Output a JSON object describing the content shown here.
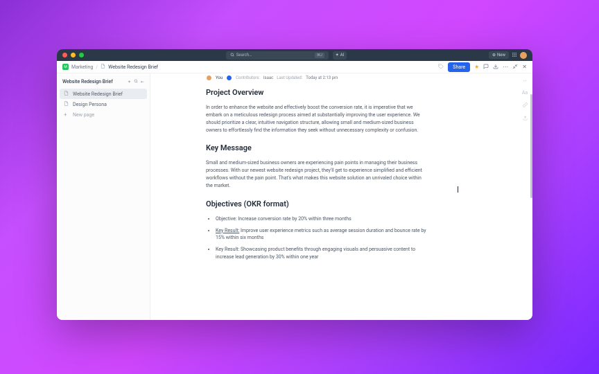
{
  "window": {
    "search_placeholder": "Search…",
    "search_shortcut": "⌘J",
    "ai_label": "AI",
    "new_label": "New"
  },
  "breadcrumbs": {
    "parent": "Marketing",
    "current": "Website Redesign Brief"
  },
  "toolbar": {
    "share_label": "Share"
  },
  "sidebar": {
    "header": "Website Redesign Brief",
    "items": [
      {
        "label": "Website Redesign Brief",
        "active": true
      },
      {
        "label": "Design Persona",
        "active": false
      }
    ],
    "new_page_label": "New page"
  },
  "doc_meta": {
    "current_user": "You",
    "contributors_label": "Contributors:",
    "contributors": "Isaac",
    "updated_label": "Last Updated:",
    "updated_value": "Today at 2:13 pm"
  },
  "document": {
    "sections": [
      {
        "heading": "Project Overview",
        "body": "In order to enhance the website and effectively boost the conversion rate, it is imperative that we embark on a meticulous redesign process aimed at substantially improving the user experience. We should prioritize a clear, intuitive navigation structure, allowing small and medium-sized business owners to effortlessly find the information they seek without unnecessary complexity or confusion."
      },
      {
        "heading": "Key Message",
        "body": "Small and medium-sized business owners are experiencing pain points in managing their business processes. With our newest website redesign project, they'll get to experience simplified and efficient workflows without the pain point. That's what makes this website solution an unrivaled choice within the market."
      },
      {
        "heading": "Objectives (OKR format)",
        "list": [
          {
            "prefix": "Objective:",
            "text": " Increase conversion rate by 20% within three months"
          },
          {
            "prefix": "Key Result:",
            "underline": true,
            "text": " Improve user experience metrics such as average session duration and bounce rate by 15% within six months"
          },
          {
            "prefix": "Key Result:",
            "text": " Showcasing product benefits through engaging visuals and persuasive content to increase lead generation by 30% within one year"
          }
        ]
      }
    ]
  }
}
